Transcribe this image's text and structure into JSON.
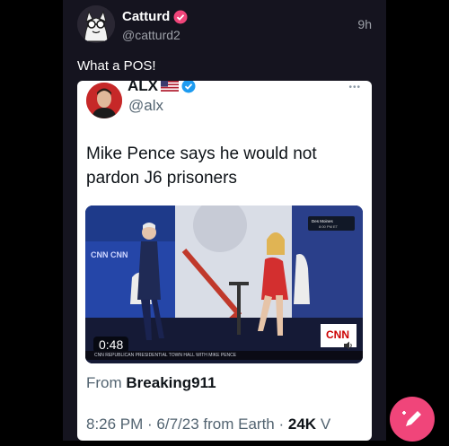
{
  "tweet": {
    "author_name": "Catturd",
    "author_handle": "@catturd2",
    "time": "9h",
    "text": "What a POS!"
  },
  "quote": {
    "author_name": "ALX",
    "author_handle": "@alx",
    "text": "Mike Pence says he would not pardon J6 prisoners",
    "more_icon": "more-dots-icon",
    "video": {
      "duration": "0:48",
      "lower_third": "CNN REPUBLICAN PRESIDENTIAL TOWN HALL WITH MIKE PENCE",
      "network_logo": "CNN",
      "corner_text": "Des Moines"
    },
    "from_label": "From",
    "from_source": "Breaking911",
    "meta_time": "8:26 PM · 6/7/23 from Earth ·",
    "meta_views": "24K",
    "meta_views_suffix": "V"
  },
  "colors": {
    "background": "#15141f",
    "verified_pink": "#f0457a",
    "verified_blue": "#1d9bf0",
    "fab": "#f0457a"
  },
  "icons": {
    "verified_badge": "verified-badge-icon",
    "compose": "compose-icon",
    "sound": "sound-icon",
    "flag": "us-flag-icon"
  }
}
